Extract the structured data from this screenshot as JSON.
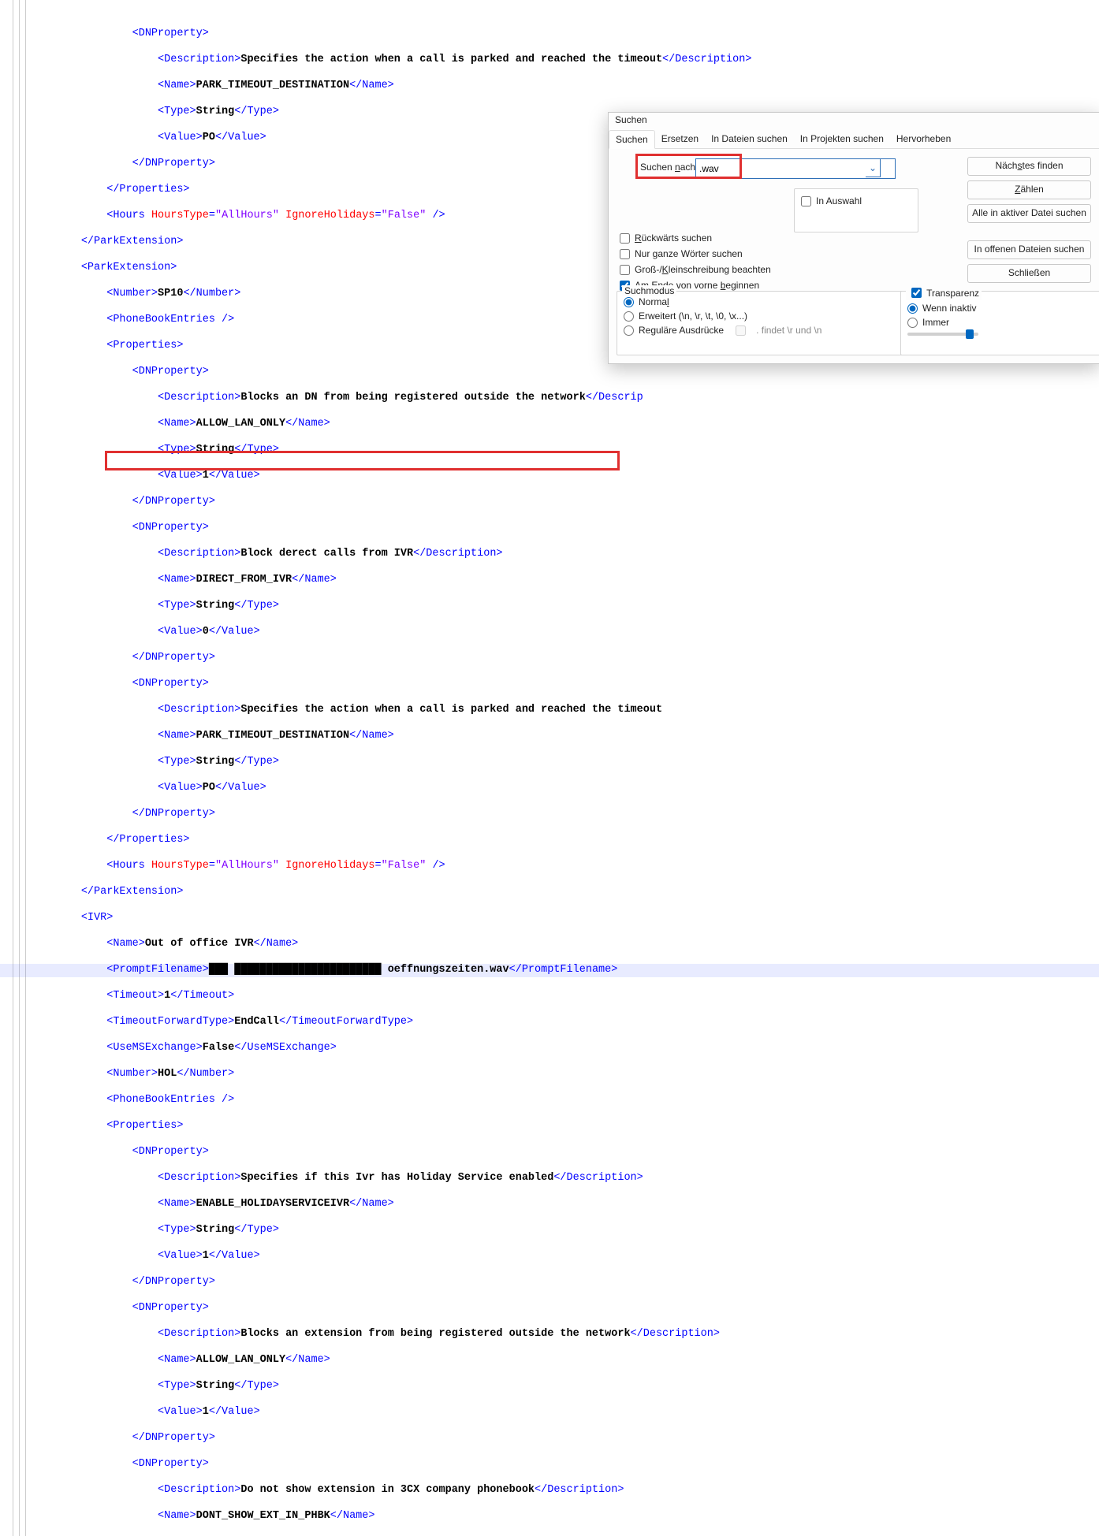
{
  "code": {
    "desc_park": "Specifies the action when a call is parked and reached the timeout",
    "park_timeout": "PARK_TIMEOUT_DESTINATION",
    "string": "String",
    "po": "PO",
    "allhours": "AllHours",
    "false": "False",
    "sp10": "SP10",
    "block_lan": "Blocks an DN from being registered outside the network",
    "allow_lan": "ALLOW_LAN_ONLY",
    "one": "1",
    "zero": "0",
    "block_ivr": "Block derect calls from IVR",
    "direct_ivr": "DIRECT_FROM_IVR",
    "ivr_name": "Out of office IVR",
    "prompt_file": "oeffnungszeiten.wav",
    "endcall": "EndCall",
    "falseV": "False",
    "hol": "HOL",
    "holiday_desc": "Specifies if this Ivr has Holiday Service enabled",
    "enable_holiday": "ENABLE_HOLIDAYSERVICEIVR",
    "block_ext": "Blocks an extension from being registered outside the network",
    "dont_show_desc": "Do not show extension in 3CX company phonebook",
    "dont_show": "DONT_SHOW_EXT_IN_PHBK"
  },
  "dlg": {
    "title": "Suchen",
    "tabs": [
      "Suchen",
      "Ersetzen",
      "In Dateien suchen",
      "In Projekten suchen",
      "Hervorheben"
    ],
    "label": "Suchen nach:",
    "value": ".wav",
    "btn_next": "Nächstes finden",
    "btn_count": "Zählen",
    "btn_all_active": "Alle in aktiver Datei suchen",
    "btn_all_open": "In offenen Dateien suchen",
    "btn_close": "Schließen",
    "in_sel": "In Auswahl",
    "back": "Rückwärts suchen",
    "whole": "Nur ganze Wörter suchen",
    "case": "Groß-/Kleinschreibung beachten",
    "wrap": "Am Ende von vorne beginnen",
    "mode": "Suchmodus",
    "normal": "Normal",
    "ext": "Erweitert (\\n, \\r, \\t, \\0, \\x...)",
    "regex": "Reguläre Ausdrücke",
    "regex2": ". findet \\r und \\n",
    "trans": "Transparenz",
    "inactive": "Wenn inaktiv",
    "always": "Immer"
  }
}
